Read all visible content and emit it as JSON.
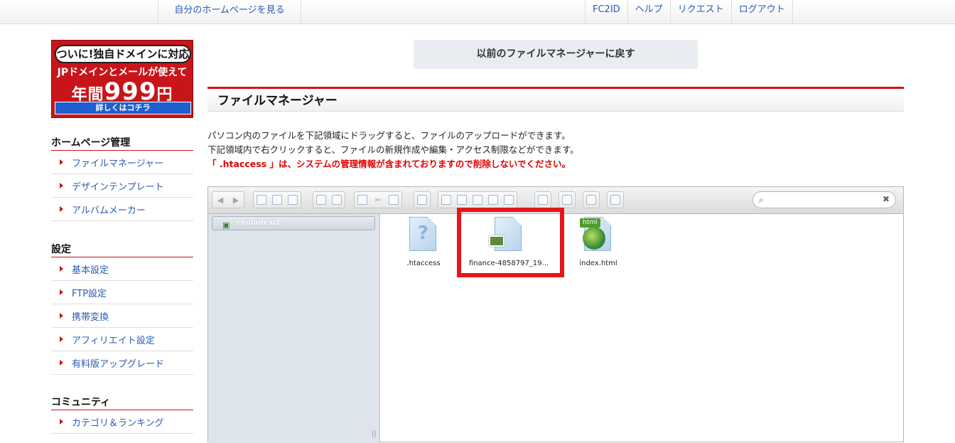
{
  "topbar": {
    "home_link": "自分のホームページを見る",
    "links": [
      "FC2ID",
      "ヘルプ",
      "リクエスト",
      "ログアウト"
    ]
  },
  "ad": {
    "line1": "ついに!独自ドメインに対応",
    "line2": "JPドメインとメールが使えて",
    "line3_prefix": "年間",
    "line3_price": "999",
    "line3_suffix": "円",
    "cta": "詳しくはコチラ"
  },
  "sidebar": {
    "sections": [
      {
        "title": "ホームページ管理",
        "items": [
          "ファイルマネージャー",
          "デザインテンプレート",
          "アルバムメーカー"
        ]
      },
      {
        "title": "設定",
        "items": [
          "基本設定",
          "FTP設定",
          "携帯変換",
          "アフィリエイト設定",
          "有料版アップグレード"
        ]
      },
      {
        "title": "コミュニティ",
        "items": [
          "カテゴリ＆ランキング"
        ]
      }
    ]
  },
  "main": {
    "back_button": "以前のファイルマネージャーに戻す",
    "heading": "ファイルマネージャー",
    "desc_line1": "パソコン内のファイルを下記領域にドラッグすると、ファイルのアップロードができます。",
    "desc_line2": "下記領域内で右クリックすると、ファイルの新規作成や編集・アクセス制限などができます。",
    "warning": "「 .htaccess 」は、システムの管理情報が含まれておりますので削除しないでください。"
  },
  "file_manager": {
    "search_placeholder": "",
    "tree_root": "chibadeai2",
    "files": [
      {
        "name": ".htaccess",
        "type": "unknown"
      },
      {
        "name": "finance-4858797_19...",
        "type": "image",
        "selected": true
      },
      {
        "name": "index.html",
        "type": "html"
      }
    ],
    "html_tag": "html",
    "grip": "||"
  },
  "colors": {
    "accent": "#d5101a",
    "link": "#2a5bb5",
    "highlight": "#e4161b"
  }
}
